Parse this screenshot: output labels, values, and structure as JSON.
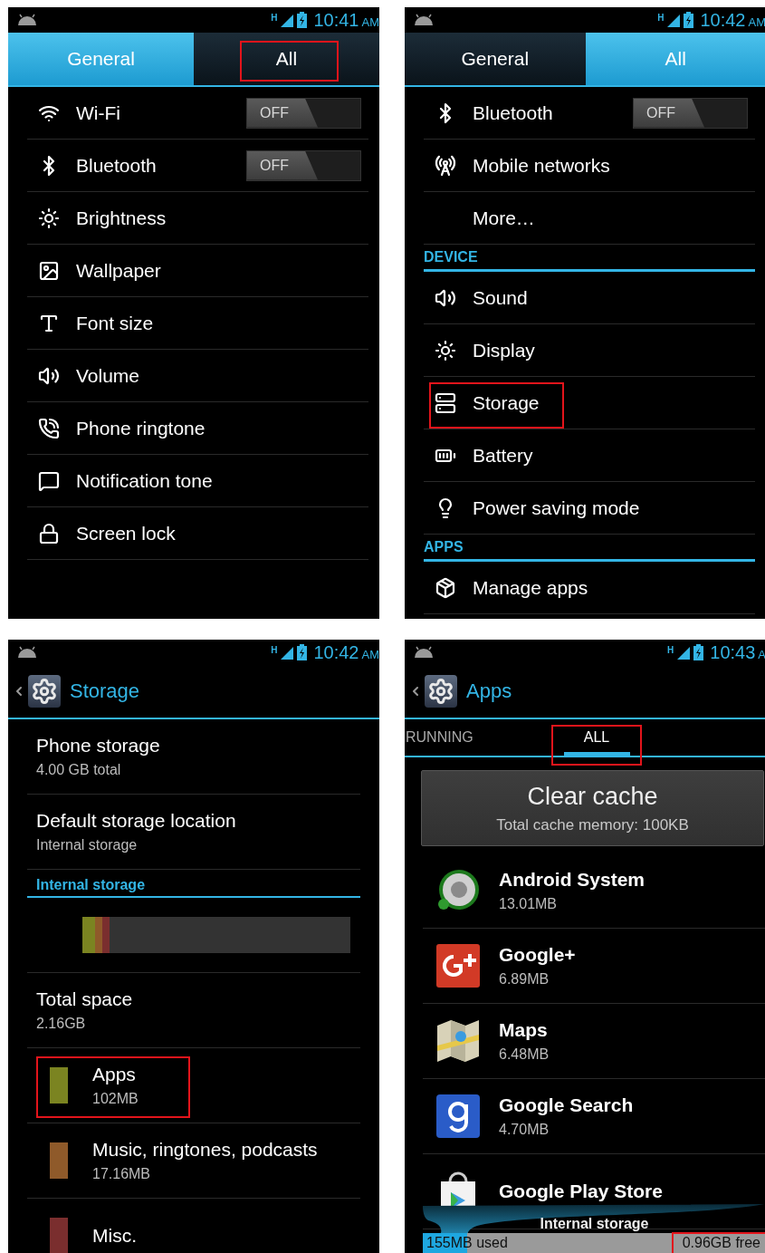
{
  "screens": [
    {
      "kind": "settings",
      "status": {
        "network": "H",
        "time": "10:41",
        "meridiem": "AM"
      },
      "tabs": [
        {
          "label": "General",
          "selected": true,
          "highlighted": false
        },
        {
          "label": "All",
          "selected": false,
          "highlighted": true
        }
      ],
      "items": [
        {
          "kind": "switch",
          "label": "Wi-Fi",
          "switch_label": "OFF",
          "on": false,
          "highlighted": false
        },
        {
          "kind": "switch",
          "label": "Bluetooth",
          "switch_label": "OFF",
          "on": false,
          "highlighted": false
        },
        {
          "kind": "plain",
          "label": "Brightness",
          "highlighted": false
        },
        {
          "kind": "plain",
          "label": "Wallpaper",
          "highlighted": false
        },
        {
          "kind": "plain",
          "label": "Font size",
          "highlighted": false
        },
        {
          "kind": "plain",
          "label": "Volume",
          "highlighted": false
        },
        {
          "kind": "plain",
          "label": "Phone ringtone",
          "highlighted": false
        },
        {
          "kind": "plain",
          "label": "Notification tone",
          "highlighted": false
        },
        {
          "kind": "plain",
          "label": "Screen lock",
          "highlighted": false
        }
      ]
    },
    {
      "kind": "settings",
      "status": {
        "network": "H",
        "time": "10:42",
        "meridiem": "AM"
      },
      "tabs": [
        {
          "label": "General",
          "selected": false,
          "highlighted": false
        },
        {
          "label": "All",
          "selected": true,
          "highlighted": false
        }
      ],
      "items": [
        {
          "kind": "switch",
          "label": "Bluetooth",
          "switch_label": "OFF",
          "on": false,
          "highlighted": false
        },
        {
          "kind": "plain",
          "label": "Mobile networks",
          "highlighted": false
        },
        {
          "kind": "plain",
          "label": "More…",
          "highlighted": false
        },
        {
          "kind": "header",
          "label": "DEVICE",
          "highlighted": false
        },
        {
          "kind": "plain",
          "label": "Sound",
          "highlighted": false
        },
        {
          "kind": "plain",
          "label": "Display",
          "highlighted": false
        },
        {
          "kind": "plain",
          "label": "Storage",
          "highlighted": true
        },
        {
          "kind": "plain",
          "label": "Battery",
          "highlighted": false
        },
        {
          "kind": "plain",
          "label": "Power saving mode",
          "highlighted": false
        },
        {
          "kind": "header",
          "label": "APPS",
          "highlighted": false
        },
        {
          "kind": "plain",
          "label": "Manage apps",
          "highlighted": false
        }
      ]
    },
    {
      "kind": "storage",
      "status": {
        "network": "H",
        "time": "10:42",
        "meridiem": "AM"
      },
      "title": "Storage",
      "rows": [
        {
          "kind": "info",
          "title": "Phone storage",
          "subtitle": "4.00 GB total",
          "highlighted": false
        },
        {
          "kind": "info",
          "title": "Default storage location",
          "subtitle": "Internal storage",
          "highlighted": false
        },
        {
          "kind": "header",
          "title": "Internal storage"
        },
        {
          "kind": "usage",
          "segments": [
            {
              "color": "#7b8421",
              "level": 0.047
            },
            {
              "color": "#8f5a2a",
              "level": 0.027
            },
            {
              "color": "#7a2e2e",
              "level": 0.027
            }
          ]
        },
        {
          "kind": "info",
          "title": "Total space",
          "subtitle": "2.16GB",
          "highlighted": false
        },
        {
          "kind": "legend",
          "title": "Apps",
          "subtitle": "102MB",
          "color": "#7b8421",
          "highlighted": true
        },
        {
          "kind": "legend",
          "title": "Music, ringtones, podcasts",
          "subtitle": "17.16MB",
          "color": "#8f5a2a",
          "highlighted": false
        },
        {
          "kind": "legend",
          "title": "Misc.",
          "color": "#7a2e2e",
          "highlighted": false
        }
      ]
    },
    {
      "kind": "apps",
      "status": {
        "network": "H",
        "time": "10:43",
        "meridiem": "A"
      },
      "title": "Apps",
      "tabs": [
        {
          "label": "RUNNING",
          "selected": false,
          "highlighted": false
        },
        {
          "label": "ALL",
          "selected": true,
          "highlighted": true
        }
      ],
      "cache_button": {
        "label": "Clear cache",
        "detail": "Total cache memory: 100KB"
      },
      "apps": [
        {
          "name": "Android System",
          "size": "13.01MB"
        },
        {
          "name": "Google+",
          "size": "6.89MB"
        },
        {
          "name": "Maps",
          "size": "6.48MB"
        },
        {
          "name": "Google Search",
          "size": "4.70MB"
        },
        {
          "name": "Google Play Store"
        }
      ],
      "storage": {
        "title": "Internal storage",
        "used": "155MB used",
        "free": "0.96GB free",
        "level": 0.13,
        "free_highlighted": true
      }
    }
  ]
}
